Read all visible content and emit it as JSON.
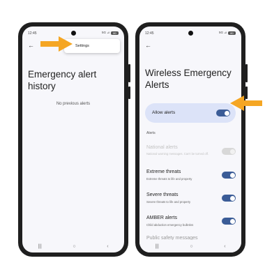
{
  "colors": {
    "accent_arrow": "#f5a623",
    "toggle_on": "#3b5c97",
    "card_bg": "#dce3f8",
    "phone_body": "#1f1f1f"
  },
  "left_phone": {
    "status": {
      "time": "12:45",
      "signal": "5G ⊿",
      "battery": "80"
    },
    "menu_popup": {
      "settings_label": "Settings"
    },
    "title": "Emergency alert history",
    "empty_text": "No previous alerts"
  },
  "right_phone": {
    "status": {
      "time": "12:45",
      "signal": "5G ⊿",
      "battery": "80"
    },
    "title": "Wireless Emergency Alerts",
    "allow_alerts": {
      "label": "Allow alerts",
      "enabled": true
    },
    "section_label": "Alerts",
    "rows": [
      {
        "title": "National alerts",
        "subtitle": "National warning messages. Can't be turned off.",
        "enabled": false,
        "disabled": true
      },
      {
        "title": "Extreme threats",
        "subtitle": "Extreme threats to life and property",
        "enabled": true,
        "disabled": false
      },
      {
        "title": "Severe threats",
        "subtitle": "Severe threats to life and property",
        "enabled": true,
        "disabled": false
      },
      {
        "title": "AMBER alerts",
        "subtitle": "Child abduction emergency bulletins",
        "enabled": true,
        "disabled": false
      },
      {
        "title": "Public safety messages",
        "subtitle": "",
        "enabled": false,
        "disabled": true
      }
    ]
  },
  "nav_icons": [
    "recents-icon",
    "home-icon",
    "back-icon"
  ]
}
